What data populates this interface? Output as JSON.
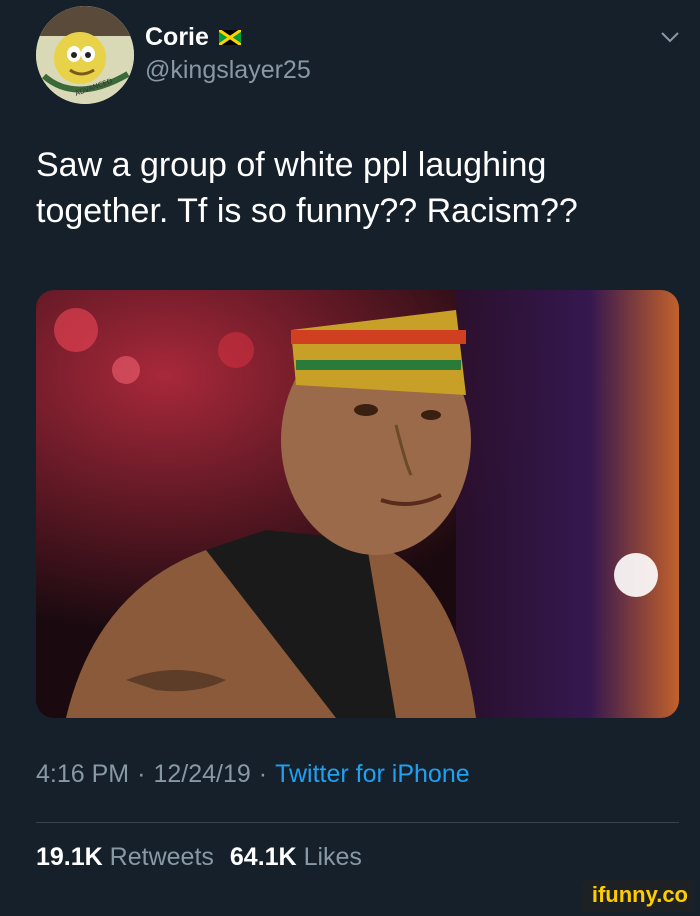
{
  "user": {
    "display_name": "Corie",
    "handle": "@kingslayer25",
    "flag_icon": "jamaica-flag-icon",
    "avatar_text": "ADVANCED NIGGA"
  },
  "tweet": {
    "text": "Saw a group of white ppl laughing together. Tf is so funny?? Racism??"
  },
  "meta": {
    "time": "4:16 PM",
    "sep1": "·",
    "date": "12/24/19",
    "sep2": "·",
    "client": "Twitter for iPhone"
  },
  "stats": {
    "retweets_count": "19.1K",
    "retweets_label": "Retweets",
    "likes_count": "64.1K",
    "likes_label": "Likes"
  },
  "watermark": "ifunny.co",
  "colors": {
    "background": "#15202b",
    "secondary_text": "#8899a6",
    "link": "#1da1f2"
  }
}
